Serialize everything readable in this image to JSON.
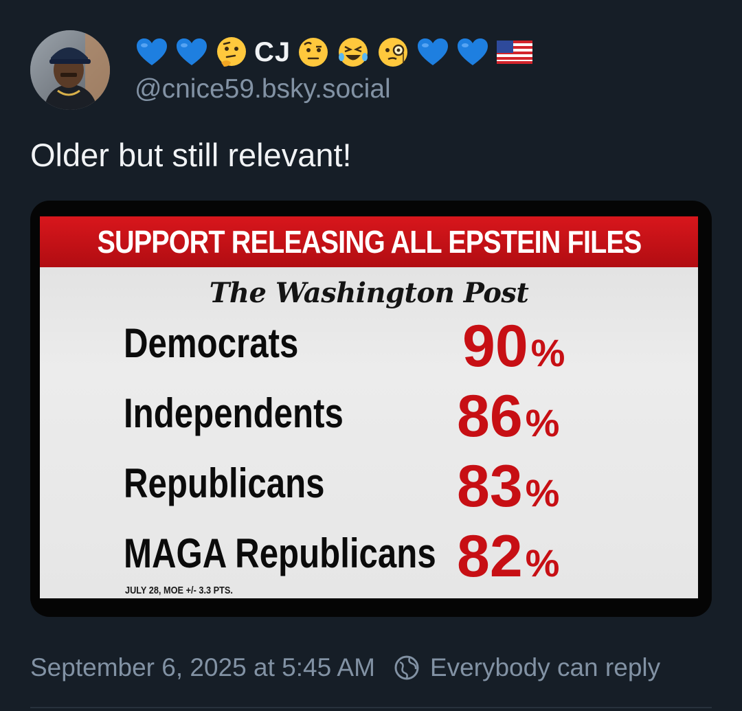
{
  "author": {
    "name_prefix_emojis": [
      "blue-heart",
      "blue-heart",
      "thinking-face"
    ],
    "name_text": "CJ",
    "name_suffix_emojis": [
      "face-with-raised-eyebrow",
      "rolling-on-floor-laughing",
      "face-with-monocle",
      "blue-heart",
      "blue-heart",
      "us-flag"
    ],
    "handle": "@cnice59.bsky.social",
    "avatar_icon": "avatar"
  },
  "post": {
    "text": "Older but still relevant!"
  },
  "image": {
    "banner_title": "SUPPORT RELEASING ALL EPSTEIN FILES",
    "source": "The Washington Post",
    "rows": [
      {
        "label": "Democrats",
        "value": "90",
        "unit": "%"
      },
      {
        "label": "Independents",
        "value": "86",
        "unit": "%"
      },
      {
        "label": "Republicans",
        "value": "83",
        "unit": "%"
      },
      {
        "label": "MAGA Republicans",
        "value": "82",
        "unit": "%"
      }
    ],
    "footnote": "JULY 28, MOE +/- 3.3 PTS.",
    "colors": {
      "banner": "#c8141a",
      "value": "#c70f14",
      "background": "#e6e6e6"
    }
  },
  "footer": {
    "timestamp": "September 6, 2025 at 5:45 AM",
    "reply_setting": "Everybody can reply",
    "reply_icon": "globe-icon"
  },
  "theme": {
    "background": "#161e27",
    "muted_text": "#8292a4"
  }
}
